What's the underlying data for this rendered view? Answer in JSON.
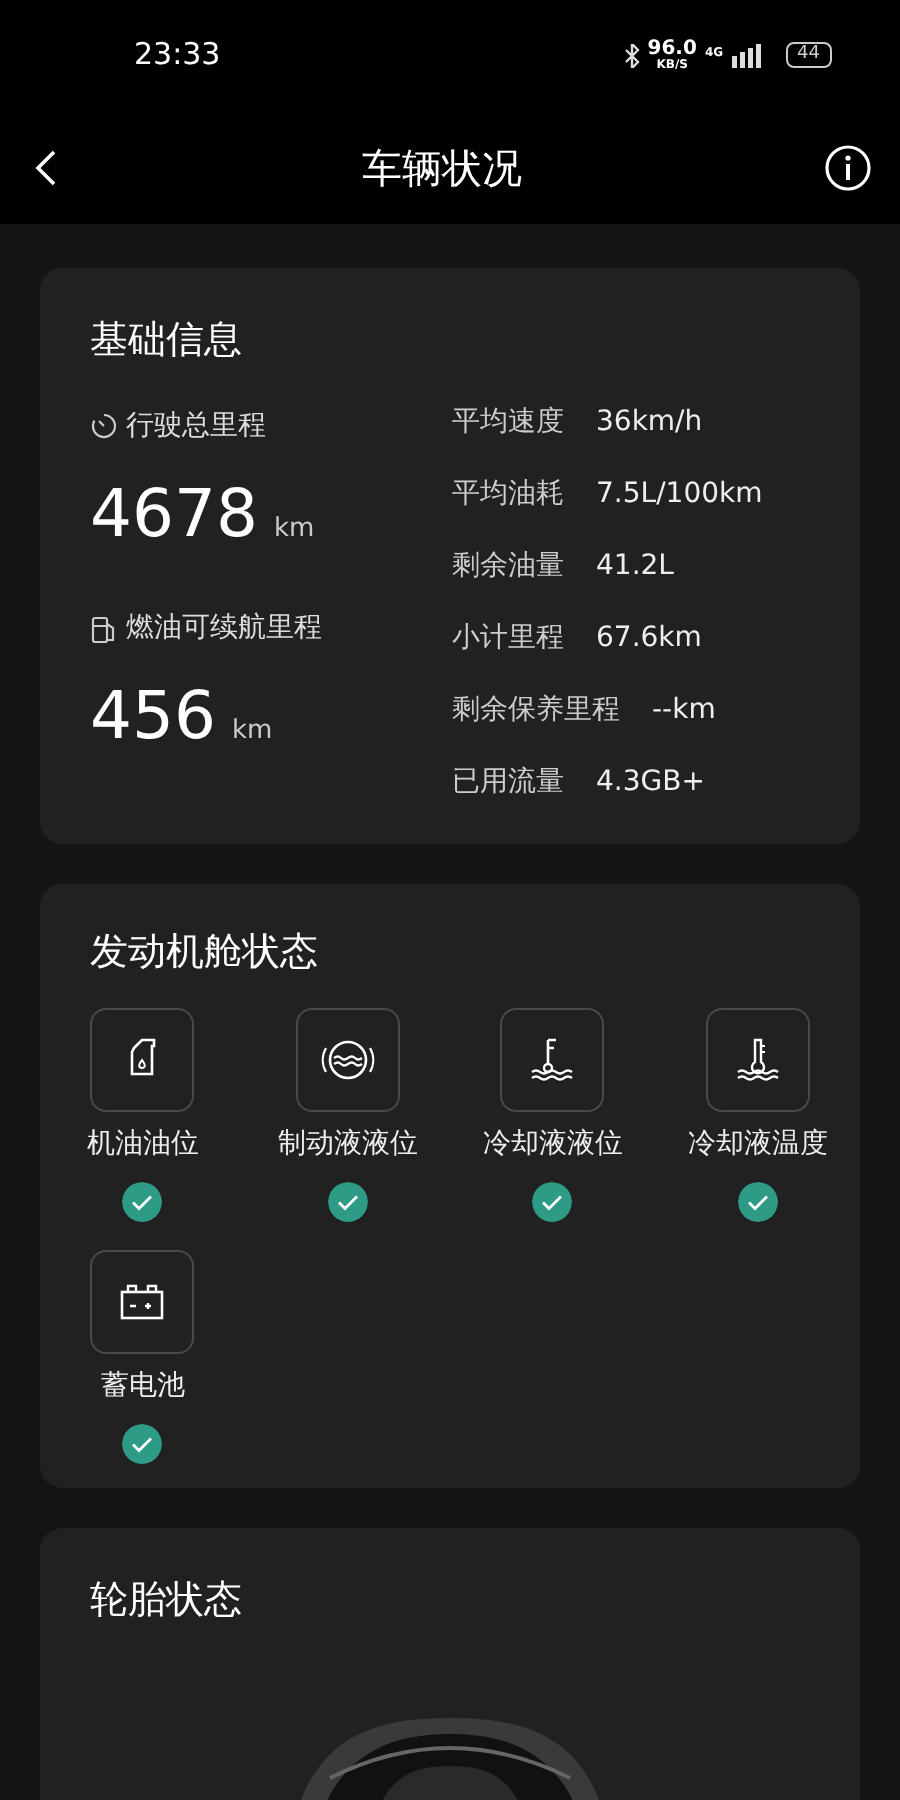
{
  "status_bar": {
    "time": "23:33",
    "net_speed": "96.0",
    "net_unit": "KB/S",
    "network": "4G",
    "battery": "44"
  },
  "header": {
    "title": "车辆状况"
  },
  "basic_info": {
    "title": "基础信息",
    "odometer": {
      "label": "行驶总里程",
      "value": "4678",
      "unit": "km"
    },
    "range": {
      "label": "燃油可续航里程",
      "value": "456",
      "unit": "km"
    },
    "stats": [
      {
        "label": "平均速度",
        "value": "36km/h"
      },
      {
        "label": "平均油耗",
        "value": "7.5L/100km"
      },
      {
        "label": "剩余油量",
        "value": "41.2L"
      },
      {
        "label": "小计里程",
        "value": "67.6km"
      },
      {
        "label": "剩余保养里程",
        "value": "--km"
      },
      {
        "label": "已用流量",
        "value": "4.3GB+"
      }
    ]
  },
  "engine_status": {
    "title": "发动机舱状态",
    "items": [
      {
        "kind": "oil",
        "label": "机油油位",
        "ok": true
      },
      {
        "kind": "brake",
        "label": "制动液液位",
        "ok": true
      },
      {
        "kind": "coolant_level",
        "label": "冷却液液位",
        "ok": true
      },
      {
        "kind": "coolant_temp",
        "label": "冷却液温度",
        "ok": true
      },
      {
        "kind": "battery",
        "label": "蓄电池",
        "ok": true
      }
    ]
  },
  "tire_status": {
    "title": "轮胎状态"
  }
}
